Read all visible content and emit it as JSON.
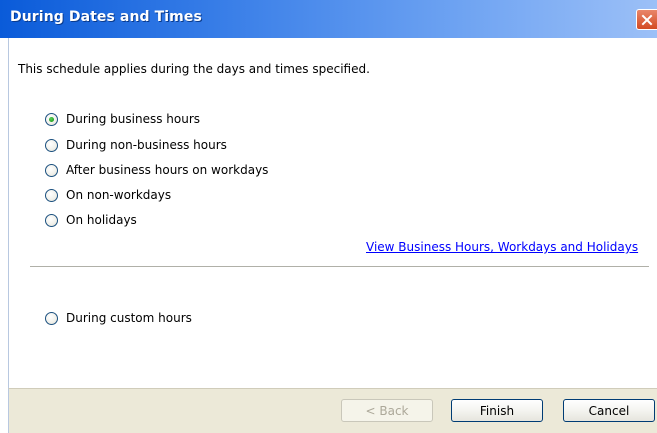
{
  "window": {
    "title": "During Dates and Times"
  },
  "description": "This schedule applies during the days and times specified.",
  "options": [
    {
      "label": "During business hours",
      "checked": true
    },
    {
      "label": "During non-business hours",
      "checked": false
    },
    {
      "label": "After business hours on workdays",
      "checked": false
    },
    {
      "label": "On non-workdays",
      "checked": false
    },
    {
      "label": "On holidays",
      "checked": false
    }
  ],
  "link": "View Business Hours, Workdays and Holidays",
  "custom_option": {
    "label": "During custom hours",
    "checked": false
  },
  "buttons": {
    "back": "< Back",
    "finish": "Finish",
    "cancel": "Cancel"
  },
  "colors": {
    "titlebar": "#0a5bd9",
    "link": "#0000ff",
    "footer": "#ece9d8",
    "close": "#d34a22"
  }
}
